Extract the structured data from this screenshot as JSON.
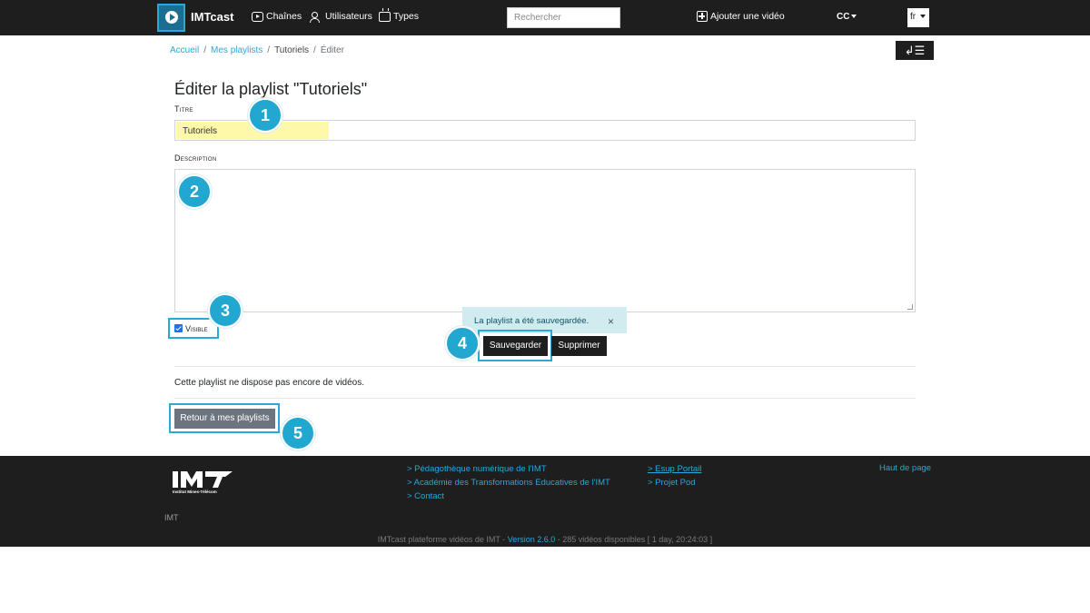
{
  "header": {
    "brand": "IMTcast",
    "nav": [
      "Chaînes",
      "Utilisateurs",
      "Types"
    ],
    "search_placeholder": "Rechercher",
    "add_video": "Ajouter une vidéo",
    "cc": "CC",
    "lang": "fr"
  },
  "breadcrumb": [
    "Accueil",
    "Mes playlists",
    "Tutoriels",
    "Éditer"
  ],
  "form": {
    "heading": "Éditer la playlist \"Tutoriels\"",
    "title_label": "Titre",
    "title_value": "Tutoriels",
    "description_label": "Description",
    "visible_label": "Visible",
    "visible_checked": true
  },
  "alert": {
    "message": "La playlist a été sauvegardée.",
    "close": "×"
  },
  "buttons": {
    "save": "Sauvegarder",
    "delete": "Supprimer",
    "back": "Retour à mes playlists"
  },
  "empty_message": "Cette playlist ne dispose pas encore de vidéos.",
  "badges": [
    "1",
    "2",
    "3",
    "4",
    "5"
  ],
  "footer": {
    "logo_sub": "Institut Mines-Télécom",
    "imt": "IMT",
    "links_col1": [
      "> Pédagothèque numérique de l'IMT",
      "> Académie des Transformations Educatives de l'IMT",
      "> Contact"
    ],
    "links_col2": [
      "> Esup Portail",
      "> Projet Pod"
    ],
    "top_link": "Haut de page",
    "credits_prefix": "IMTcast plateforme vidéos de IMT - ",
    "version": "Version 2.6.0",
    "credits_suffix": " - 285 vidéos disponibles [ 1 day, 20:24:03 ]"
  },
  "colors": {
    "accent": "#2aa8d8",
    "navbar": "#1e1e1e",
    "highlight": "#fdf9a9",
    "alert_bg": "#d1ecf1"
  }
}
